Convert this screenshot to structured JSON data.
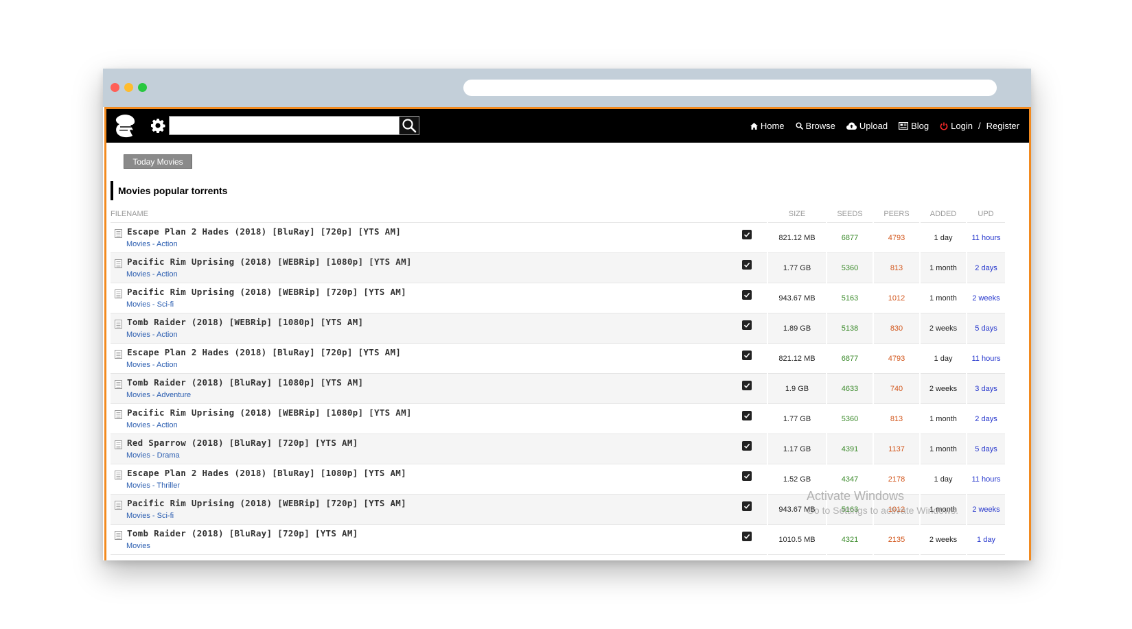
{
  "nav": {
    "links": [
      {
        "icon": "home-icon",
        "label": "Home"
      },
      {
        "icon": "search-icon",
        "label": "Browse"
      },
      {
        "icon": "cloud-upload-icon",
        "label": "Upload"
      },
      {
        "icon": "newspaper-icon",
        "label": "Blog"
      }
    ],
    "login": {
      "icon": "power-icon",
      "label": "Login",
      "separator": "/",
      "register": "Register"
    }
  },
  "search": {
    "placeholder": ""
  },
  "today_button": "Today Movies",
  "section_title": "Movies popular torrents",
  "columns": {
    "filename": "FILENAME",
    "size": "SIZE",
    "seeds": "SEEDS",
    "peers": "PEERS",
    "added": "ADDED",
    "upd": "UPD"
  },
  "rows": [
    {
      "title": "Escape Plan 2 Hades (2018) [BluRay] [720p] [YTS AM]",
      "cat": "Movies",
      "sub": "Action",
      "size": "821.12 MB",
      "seeds": "6877",
      "peers": "4793",
      "added": "1 day",
      "upd": "11 hours"
    },
    {
      "title": "Pacific Rim Uprising (2018) [WEBRip] [1080p] [YTS AM]",
      "cat": "Movies",
      "sub": "Action",
      "size": "1.77 GB",
      "seeds": "5360",
      "peers": "813",
      "added": "1 month",
      "upd": "2 days"
    },
    {
      "title": "Pacific Rim Uprising (2018) [WEBRip] [720p] [YTS AM]",
      "cat": "Movies",
      "sub": "Sci-fi",
      "size": "943.67 MB",
      "seeds": "5163",
      "peers": "1012",
      "added": "1 month",
      "upd": "2 weeks"
    },
    {
      "title": "Tomb Raider (2018) [WEBRip] [1080p] [YTS AM]",
      "cat": "Movies",
      "sub": "Action",
      "size": "1.89 GB",
      "seeds": "5138",
      "peers": "830",
      "added": "2 weeks",
      "upd": "5 days"
    },
    {
      "title": "Escape Plan 2 Hades (2018) [BluRay] [720p] [YTS AM]",
      "cat": "Movies",
      "sub": "Action",
      "size": "821.12 MB",
      "seeds": "6877",
      "peers": "4793",
      "added": "1 day",
      "upd": "11 hours"
    },
    {
      "title": "Tomb Raider (2018) [BluRay] [1080p] [YTS AM]",
      "cat": "Movies",
      "sub": "Adventure",
      "size": "1.9 GB",
      "seeds": "4633",
      "peers": "740",
      "added": "2 weeks",
      "upd": "3 days"
    },
    {
      "title": "Pacific Rim Uprising (2018) [WEBRip] [1080p] [YTS AM]",
      "cat": "Movies",
      "sub": "Action",
      "size": "1.77 GB",
      "seeds": "5360",
      "peers": "813",
      "added": "1 month",
      "upd": "2 days"
    },
    {
      "title": "Red Sparrow (2018) [BluRay] [720p] [YTS AM]",
      "cat": "Movies",
      "sub": "Drama",
      "size": "1.17 GB",
      "seeds": "4391",
      "peers": "1137",
      "added": "1 month",
      "upd": "5 days"
    },
    {
      "title": "Escape Plan 2 Hades (2018) [BluRay] [1080p] [YTS AM]",
      "cat": "Movies",
      "sub": "Thriller",
      "size": "1.52 GB",
      "seeds": "4347",
      "peers": "2178",
      "added": "1 day",
      "upd": "11 hours"
    },
    {
      "title": "Pacific Rim Uprising (2018) [WEBRip] [720p] [YTS AM]",
      "cat": "Movies",
      "sub": "Sci-fi",
      "size": "943.67 MB",
      "seeds": "5163",
      "peers": "1012",
      "added": "1 month",
      "upd": "2 weeks"
    },
    {
      "title": "Tomb Raider (2018) [BluRay] [720p] [YTS AM]",
      "cat": "Movies",
      "sub": "",
      "size": "1010.5 MB",
      "seeds": "4321",
      "peers": "2135",
      "added": "2 weeks",
      "upd": "1 day"
    }
  ],
  "watermark": {
    "line1": "Activate Windows",
    "line2": "Go to Settings to activate Windows."
  }
}
